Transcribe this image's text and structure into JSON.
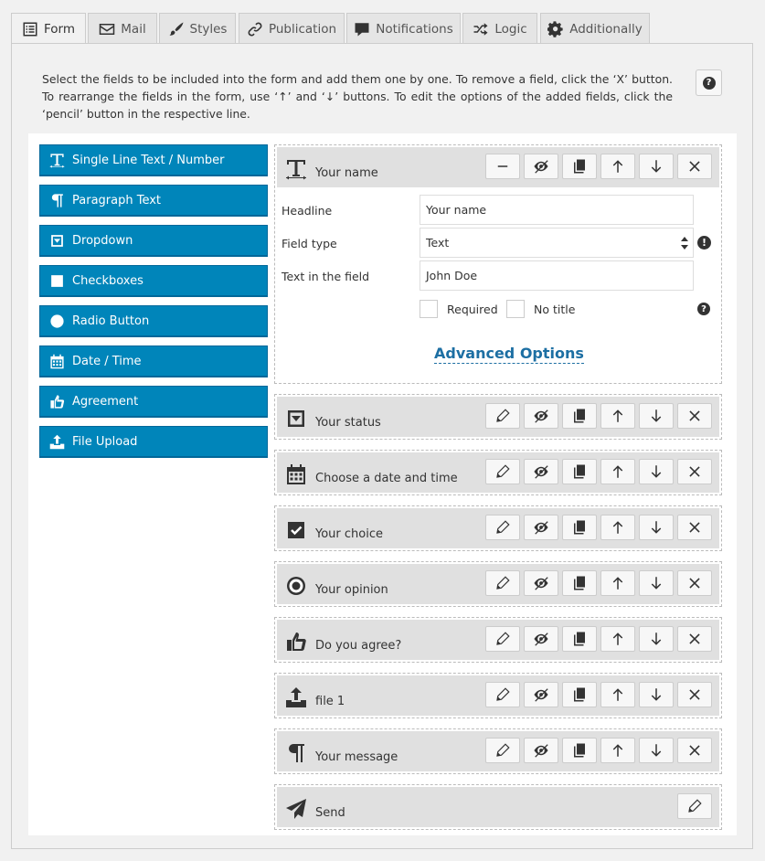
{
  "tabs": [
    {
      "label": "Form",
      "icon": "form-list-icon",
      "active": true
    },
    {
      "label": "Mail",
      "icon": "envelope-icon",
      "active": false
    },
    {
      "label": "Styles",
      "icon": "brush-icon",
      "active": false
    },
    {
      "label": "Publication",
      "icon": "link-icon",
      "active": false
    },
    {
      "label": "Notifications",
      "icon": "comment-icon",
      "active": false
    },
    {
      "label": "Logic",
      "icon": "shuffle-icon",
      "active": false
    },
    {
      "label": "Additionally",
      "icon": "gear-icon",
      "active": false
    }
  ],
  "description": "Select the fields to be included into the form and add them one by one. To remove a field, click the ‘X’ button. To rearrange the fields in the form, use ‘↑’ and ‘↓’ buttons. To edit the options of the added fields, click the ‘pencil’ button in the respective line.",
  "help_label": "?",
  "field_types": [
    {
      "label": "Single Line Text / Number",
      "icon": "text-icon"
    },
    {
      "label": "Paragraph Text",
      "icon": "paragraph-icon"
    },
    {
      "label": "Dropdown",
      "icon": "dropdown-icon"
    },
    {
      "label": "Checkboxes",
      "icon": "checkbox-icon"
    },
    {
      "label": "Radio Button",
      "icon": "radio-icon"
    },
    {
      "label": "Date / Time",
      "icon": "calendar-icon"
    },
    {
      "label": "Agreement",
      "icon": "thumbs-up-icon"
    },
    {
      "label": "File Upload",
      "icon": "upload-icon"
    }
  ],
  "expanded_field": {
    "title": "Your name",
    "icon": "text-icon",
    "headline_label": "Headline",
    "headline_value": "Your name",
    "field_type_label": "Field type",
    "field_type_value": "Text",
    "text_in_field_label": "Text in the field",
    "text_in_field_value": "John Doe",
    "required_label": "Required",
    "no_title_label": "No title",
    "advanced_label": "Advanced Options",
    "exclamation": "!",
    "question": "?"
  },
  "fields": [
    {
      "title": "Your status",
      "icon": "dropdown-icon"
    },
    {
      "title": "Choose a date and time",
      "icon": "calendar-icon"
    },
    {
      "title": "Your choice",
      "icon": "checkbox-icon"
    },
    {
      "title": "Your opinion",
      "icon": "radio-icon"
    },
    {
      "title": "Do you agree?",
      "icon": "thumbs-up-icon"
    },
    {
      "title": "file 1",
      "icon": "upload-icon"
    },
    {
      "title": "Your message",
      "icon": "paragraph-icon"
    }
  ],
  "send_field": {
    "title": "Send",
    "icon": "paper-plane-icon"
  },
  "colors": {
    "accent": "#0085ba",
    "link": "#1d6fa3",
    "header_bg": "#e0e0e0"
  }
}
